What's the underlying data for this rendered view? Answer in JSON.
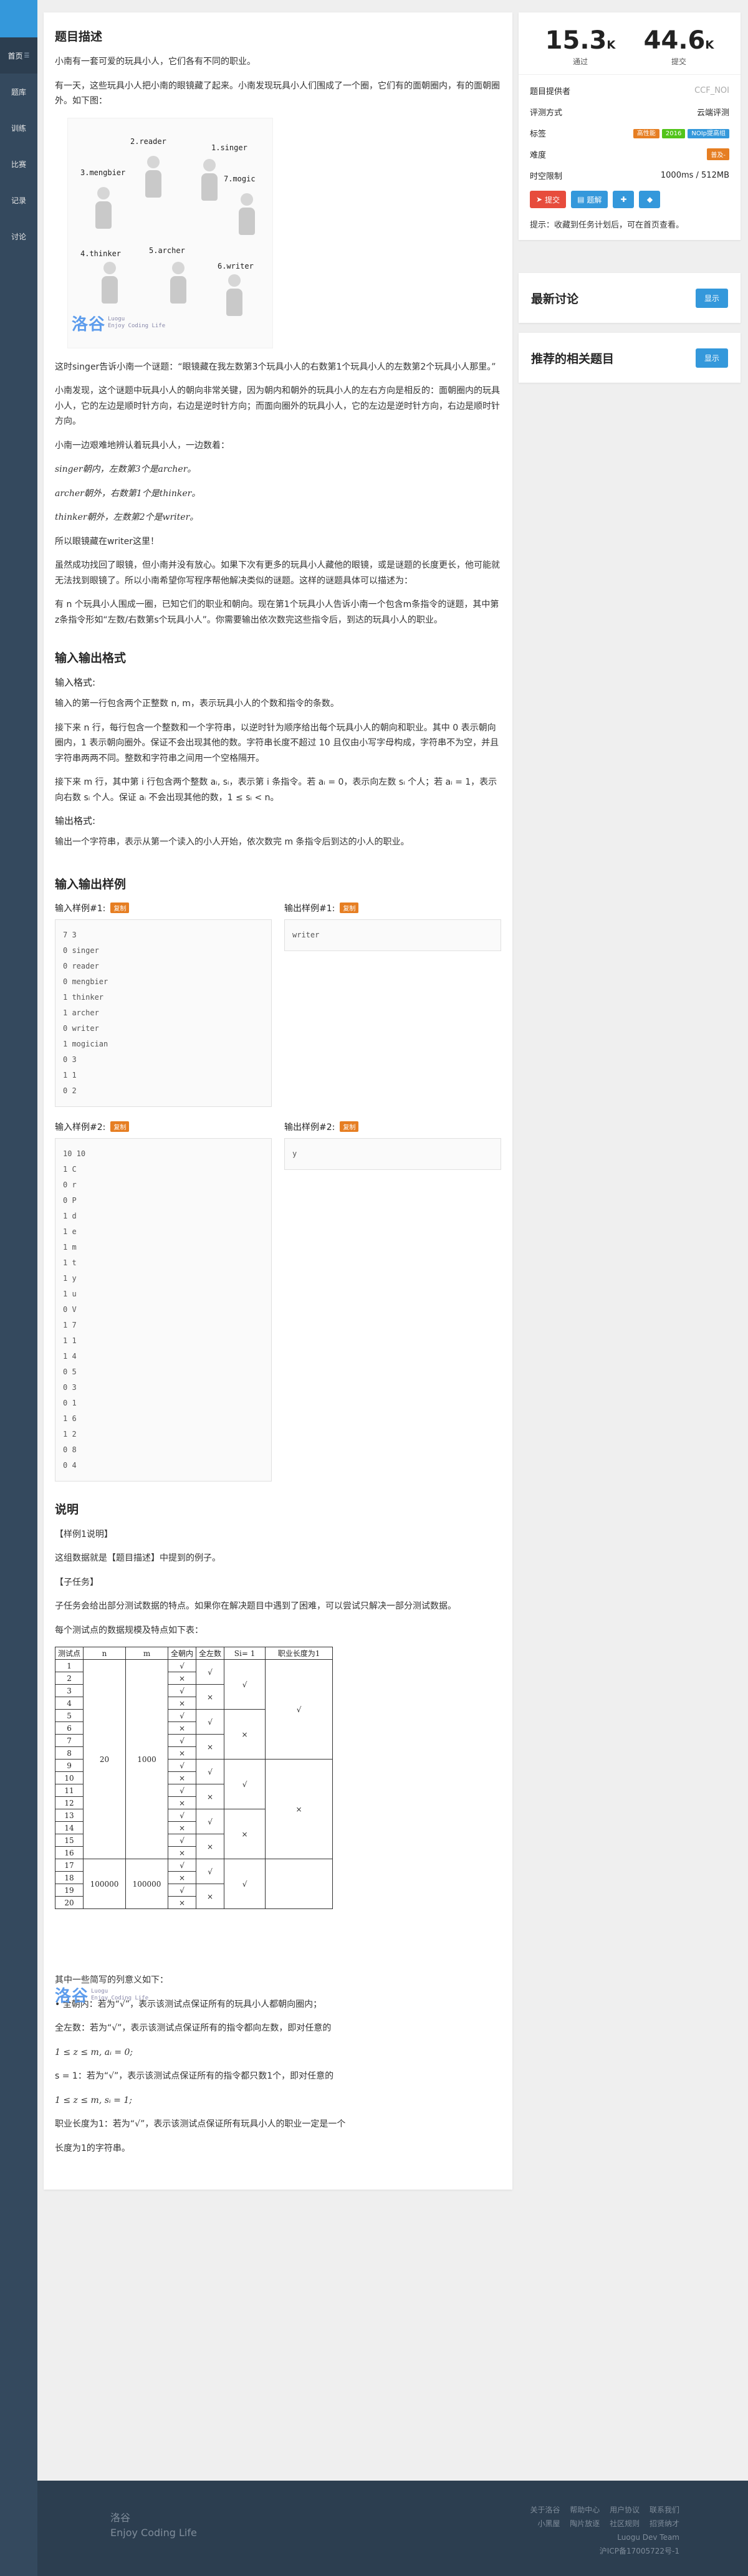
{
  "nav": {
    "items": [
      "首页",
      "题库",
      "训练",
      "比赛",
      "记录",
      "讨论"
    ],
    "home_badge": "☰"
  },
  "problem": {
    "desc_title": "题目描述",
    "p1": "小南有一套可爱的玩具小人，它们各有不同的职业。",
    "p2": "有一天，这些玩具小人把小南的眼镜藏了起来。小南发现玩具小人们围成了一个圈，它们有的面朝圈内，有的面朝圈外。如下图：",
    "figure_labels": [
      "2.reader",
      "1.singer",
      "3.mengbier",
      "7.mogic",
      "4.thinker",
      "5.archer",
      "6.writer"
    ],
    "p3": "这时singer告诉小南一个谜题：“眼镜藏在我左数第3个玩具小人的右数第1个玩具小人的左数第2个玩具小人那里。”",
    "p4": "小南发现，这个谜题中玩具小人的朝向非常关键，因为朝内和朝外的玩具小人的左右方向是相反的：面朝圈内的玩具小人，它的左边是顺时针方向，右边是逆时针方向；而面向圈外的玩具小人，它的左边是逆时针方向，右边是顺时针方向。",
    "p5": "小南一边艰难地辨认着玩具小人，一边数着：",
    "m1": "singer朝内，左数第3个是archer。",
    "m2": "archer朝外，右数第1个是thinker。",
    "m3": "thinker朝外，左数第2个是writer。",
    "p6": "所以眼镜藏在writer这里！",
    "p7": "虽然成功找回了眼镜，但小南并没有放心。如果下次有更多的玩具小人藏他的眼镜，或是谜题的长度更长，他可能就无法找到眼镜了。所以小南希望你写程序帮他解决类似的谜题。这样的谜题具体可以描述为：",
    "p8": "有 n 个玩具小人围成一圈，已知它们的职业和朝向。现在第1个玩具小人告诉小南一个包含m条指令的谜题，其中第 z条指令形如“左数/右数第s个玩具小人”。你需要输出依次数完这些指令后，到达的玩具小人的职业。",
    "io_title": "输入输出格式",
    "in_fmt_title": "输入格式:",
    "in1": "输入的第一行包含两个正整数 n, m，表示玩具小人的个数和指令的条数。",
    "in2": "接下来 n 行，每行包含一个整数和一个字符串，以逆时针为顺序给出每个玩具小人的朝向和职业。其中 0 表示朝向圈内，1 表示朝向圈外。保证不会出现其他的数。字符串长度不超过 10 且仅由小写字母构成，字符串不为空，并且字符串两两不同。整数和字符串之间用一个空格隔开。",
    "in3": "接下来 m 行，其中第 i 行包含两个整数 aᵢ, sᵢ，表示第 i 条指令。若 aᵢ = 0，表示向左数 sᵢ 个人；若 aᵢ = 1，表示向右数 sᵢ 个人。保证 aᵢ 不会出现其他的数，1 ≤ sᵢ < n。",
    "out_fmt_title": "输出格式:",
    "out1": "输出一个字符串，表示从第一个读入的小人开始，依次数完 m 条指令后到达的小人的职业。",
    "samples_title": "输入输出样例",
    "in_label_1": "输入样例#1:",
    "out_label_1": "输出样例#1:",
    "in_label_2": "输入样例#2:",
    "out_label_2": "输出样例#2:",
    "copy": "复制",
    "sample_in_1": "7 3\n0 singer\n0 reader\n0 mengbier\n1 thinker\n1 archer\n0 writer\n1 mogician\n0 3\n1 1\n0 2",
    "sample_out_1": "writer",
    "sample_in_2": "10 10\n1 C\n0 r\n0 P\n1 d\n1 e\n1 m\n1 t\n1 y\n1 u\n0 V\n1 7\n1 1\n1 4\n0 5\n0 3\n0 1\n1 6\n1 2\n0 8\n0 4",
    "sample_out_2": "y",
    "note_title": "说明",
    "n1": "【样例1说明】",
    "n2": "这组数据就是【题目描述】中提到的例子。",
    "n3": "【子任务】",
    "n4": "子任务会给出部分测试数据的特点。如果你在解决题目中遇到了困难，可以尝试只解决一部分测试数据。",
    "n5": "每个测试点的数据规模及特点如下表：",
    "n6": "其中一些简写的列意义如下：",
    "n7": "• 全朝内：若为“√”，表示该测试点保证所有的玩具小人都朝向圈内；",
    "n8": "全左数：若为“√”，表示该测试点保证所有的指令都向左数，即对任意的",
    "n9": "1 ≤ z ≤ m, aᵢ = 0;",
    "n10": "s = 1：若为“√”，表示该测试点保证所有的指令都只数1个，即对任意的",
    "n11": "1 ≤ z ≤ m, sᵢ = 1;",
    "n12": "职业长度为1：若为“√”，表示该测试点保证所有玩具小人的职业一定是一个",
    "n13": "长度为1的字符串。",
    "watermark": "洛谷",
    "watermark_sub": "Luogu\nEnjoy Coding Life"
  },
  "table": {
    "headers": [
      "测试点",
      "n",
      "m",
      "全朝内",
      "全左数",
      "Si= 1",
      "职业长度为1"
    ],
    "tests": [
      "1",
      "2",
      "3",
      "4",
      "5",
      "6",
      "7",
      "8",
      "9",
      "10",
      "11",
      "12",
      "13",
      "14",
      "15",
      "16",
      "17",
      "18",
      "19",
      "20"
    ],
    "n_small": "20",
    "m_small": "1000",
    "n_big": "100000",
    "m_big": "100000",
    "col_inward": [
      "√",
      "×",
      "√",
      "×",
      "√",
      "×",
      "√",
      "×",
      "√",
      "×",
      "√",
      "×",
      "√",
      "×",
      "√",
      "×",
      "√",
      "×",
      "√",
      "×"
    ],
    "col_left": [
      "√",
      "×",
      "√",
      "×",
      "√",
      "×",
      "√",
      "×"
    ],
    "col_s1": [
      "√",
      "×",
      "√",
      "×"
    ],
    "col_len1": [
      "√",
      "×"
    ],
    "check": "√",
    "cross": "×"
  },
  "side": {
    "accepted": "15.3",
    "accepted_unit": "K",
    "accepted_label": "通过",
    "submitted": "44.6",
    "submitted_unit": "K",
    "submitted_label": "提交",
    "provider_label": "题目提供者",
    "provider": "CCF_NOI",
    "judge_label": "评测方式",
    "judge": "云端评测",
    "tags_label": "标签",
    "tags": [
      "高性能",
      "2016",
      "NOIp提高组"
    ],
    "tag_colors": [
      "#e67e22",
      "#52c41a",
      "#3498db"
    ],
    "difficulty_label": "难度",
    "difficulty": "普及-",
    "difficulty_color": "#e67e22",
    "limit_label": "时空限制",
    "limit": "1000ms / 512MB",
    "btn_submit": "提交",
    "btn_solution": "题解",
    "hint": "提示：收藏到任务计划后，可在首页查看。",
    "discuss_title": "最新讨论",
    "related_title": "推荐的相关题目",
    "show": "显示"
  },
  "footer": {
    "brand_1": "洛谷",
    "brand_2": "Enjoy Coding Life",
    "links_1": [
      "关于洛谷",
      "帮助中心",
      "用户协议",
      "联系我们"
    ],
    "links_2": [
      "小黑屋",
      "陶片放逐",
      "社区规则",
      "招贤纳才"
    ],
    "team": "Luogu Dev Team",
    "icp": "沪ICP备17005722号-1"
  }
}
